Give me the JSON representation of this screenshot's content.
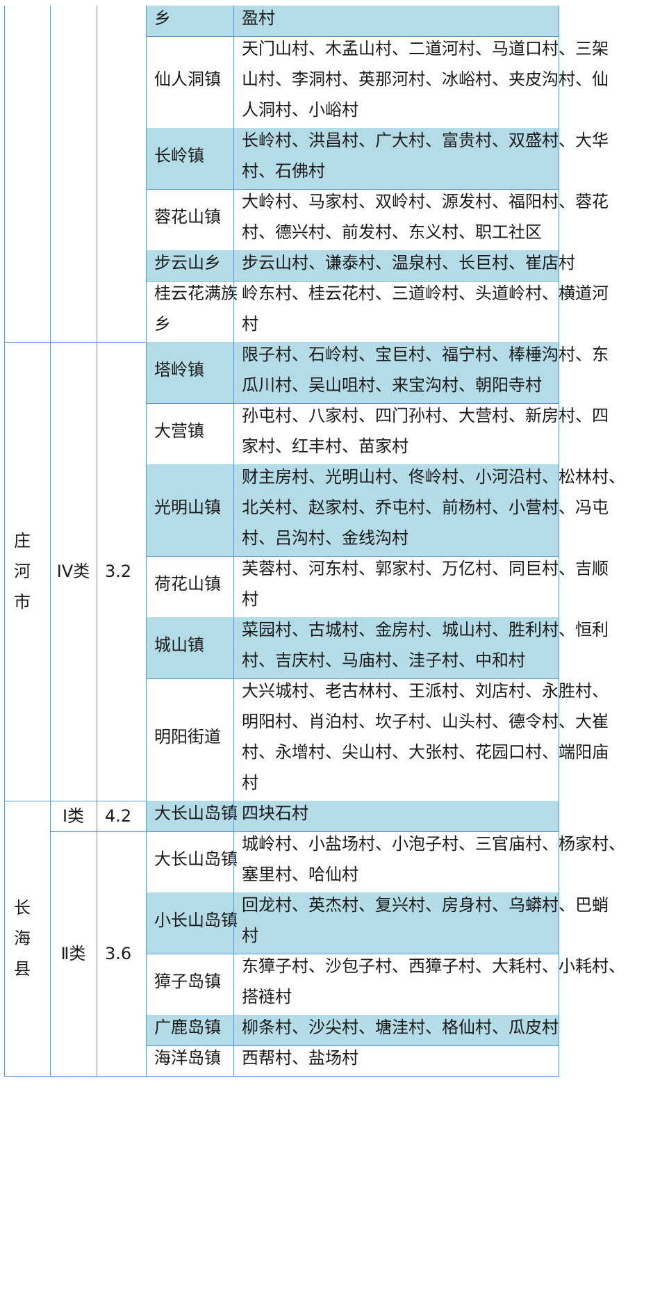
{
  "regions": [
    {
      "rows": [
        {
          "town": [
            "乡"
          ],
          "villages": [
            "盈村"
          ],
          "hl": true
        },
        {
          "town": [
            "仙人洞镇"
          ],
          "villages": [
            "天门山村、木孟山村、二道河村、马道口村、三架",
            "山村、李洞村、英那河村、冰峪村、夹皮沟村、仙",
            "人洞村、小峪村"
          ],
          "hl": false
        },
        {
          "town": [
            "长岭镇"
          ],
          "villages": [
            "长岭村、洪昌村、广大村、富贵村、双盛村、大华",
            "村、石佛村"
          ],
          "hl": true
        },
        {
          "town": [
            "蓉花山镇"
          ],
          "villages": [
            "大岭村、马家村、双岭村、源发村、福阳村、蓉花",
            "村、德兴村、前发村、东义村、职工社区"
          ],
          "hl": false
        },
        {
          "town": [
            "步云山乡"
          ],
          "villages": [
            "步云山村、谦泰村、温泉村、长巨村、崔店村"
          ],
          "hl": true
        },
        {
          "town": [
            "桂云花满族",
            "乡"
          ],
          "villages": [
            "岭东村、桂云花村、三道岭村、头道岭村、横道河",
            "村"
          ],
          "hl": false
        }
      ]
    },
    {
      "county": [
        "庄",
        "河",
        "市"
      ],
      "category": "IV类",
      "coef": "3.2",
      "rows": [
        {
          "town": [
            "塔岭镇"
          ],
          "villages": [
            "限子村、石岭村、宝巨村、福宁村、棒棰沟村、东",
            "瓜川村、吴山咀村、来宝沟村、朝阳寺村"
          ],
          "hl": true
        },
        {
          "town": [
            "大营镇"
          ],
          "villages": [
            "孙屯村、八家村、四门孙村、大营村、新房村、四",
            "家村、红丰村、苗家村"
          ],
          "hl": false
        },
        {
          "town": [
            "光明山镇"
          ],
          "villages": [
            "财主房村、光明山村、佟岭村、小河沿村、松林村、",
            "北关村、赵家村、乔屯村、前杨村、小营村、冯屯",
            "村、吕沟村、金线沟村"
          ],
          "hl": true
        },
        {
          "town": [
            "荷花山镇"
          ],
          "villages": [
            "芙蓉村、河东村、郭家村、万亿村、同巨村、吉顺",
            "村"
          ],
          "hl": false
        },
        {
          "town": [
            "城山镇"
          ],
          "villages": [
            "菜园村、古城村、金房村、城山村、胜利村、恒利",
            "村、吉庆村、马庙村、洼子村、中和村"
          ],
          "hl": true
        },
        {
          "town": [
            "明阳街道"
          ],
          "villages": [
            "大兴城村、老古林村、王派村、刘店村、永胜村、",
            "明阳村、肖泊村、坎子村、山头村、德令村、大崔",
            "村、永增村、尖山村、大张村、花园口村、端阳庙",
            "村"
          ],
          "hl": false
        }
      ]
    },
    {
      "county": [
        "长",
        "海",
        "县"
      ],
      "groups": [
        {
          "category": "Ⅰ类",
          "coef": "4.2",
          "rows": [
            {
              "town": [
                "大长山岛镇"
              ],
              "villages": [
                "四块石村"
              ],
              "hl": true
            }
          ]
        },
        {
          "category": "Ⅱ类",
          "coef": "3.6",
          "rows": [
            {
              "town": [
                "大长山岛镇"
              ],
              "villages": [
                "城岭村、小盐场村、小泡子村、三官庙村、杨家村、",
                "塞里村、哈仙村"
              ],
              "hl": false
            },
            {
              "town": [
                "小长山岛镇"
              ],
              "villages": [
                "回龙村、英杰村、复兴村、房身村、乌蟒村、巴蛸",
                "村"
              ],
              "hl": true
            },
            {
              "town": [
                "獐子岛镇"
              ],
              "villages": [
                "东獐子村、沙包子村、西獐子村、大耗村、小耗村、",
                "搭裢村"
              ],
              "hl": false
            },
            {
              "town": [
                "广鹿岛镇"
              ],
              "villages": [
                "柳条村、沙尖村、塘洼村、格仙村、瓜皮村"
              ],
              "hl": true
            },
            {
              "town": [
                "海洋岛镇"
              ],
              "villages": [
                "西帮村、盐场村"
              ],
              "hl": false
            }
          ]
        }
      ]
    }
  ],
  "colors": {
    "border": "#5b9bd5",
    "highlight": "#b4dce6",
    "text": "#1a1a1a"
  }
}
